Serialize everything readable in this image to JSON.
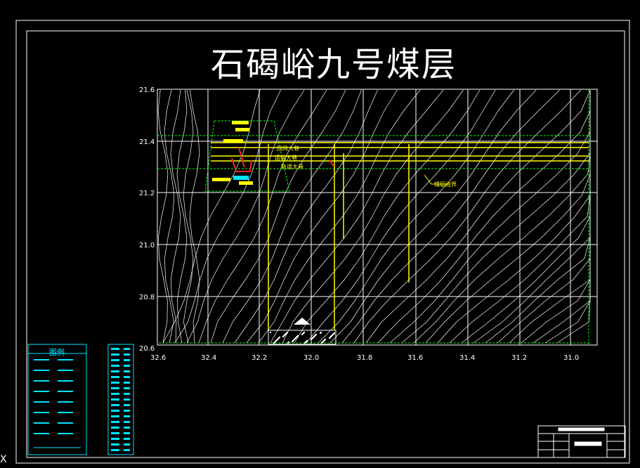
{
  "title": "石碣峪九号煤层",
  "y_axis_labels": [
    "21.6",
    "21.4",
    "21.2",
    "21.0",
    "20.8",
    "20.6"
  ],
  "x_axis_labels": [
    "32.6",
    "32.4",
    "32.2",
    "32.0",
    "31.8",
    "31.6",
    "31.4",
    "31.2",
    "31.0"
  ],
  "roadways": [
    "回风大巷",
    "运输大巷",
    "轨道大巷"
  ],
  "coal_boundary_label": "煤层边界",
  "legend": {
    "title": "图例"
  },
  "corner_mark": "X",
  "colors": {
    "background": "#000000",
    "frame": "#ffffff",
    "contour": "#ffffff",
    "grid": "#ffffff",
    "boundary": "#00ff00",
    "roadway": "#ffff00",
    "workings": "#ff2020",
    "legend": "#00e5ff"
  }
}
